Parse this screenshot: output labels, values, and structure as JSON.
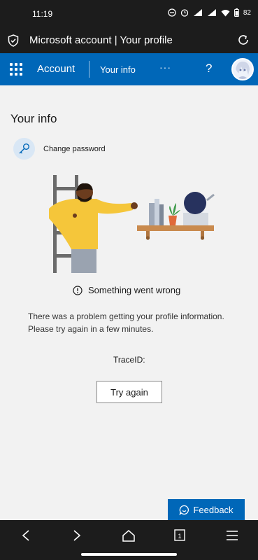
{
  "status_bar": {
    "time": "11:19",
    "battery": "82"
  },
  "browser": {
    "title": "Microsoft account | Your profile"
  },
  "header": {
    "account_label": "Account",
    "nav_item": "Your info",
    "more_label": "···",
    "help_label": "?"
  },
  "main": {
    "page_title": "Your info",
    "change_password": "Change password",
    "error_title": "Something went wrong",
    "error_description": "There was a problem getting your profile information. Please try again in a few minutes.",
    "trace_label": "TraceID:",
    "try_again": "Try again"
  },
  "feedback": {
    "label": "Feedback"
  },
  "colors": {
    "brand_blue": "#0067b8",
    "page_background": "#f2f2f2"
  }
}
